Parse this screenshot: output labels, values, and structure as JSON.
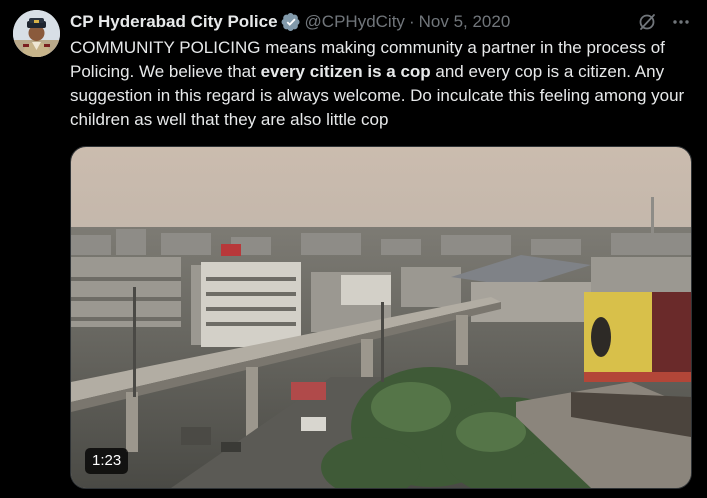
{
  "tweet": {
    "display_name": "CP Hyderabad City Police",
    "handle": "@CPHydCity",
    "separator": "·",
    "date": "Nov 5, 2020",
    "text_1": "COMMUNITY POLICING means making community a partner in the process of Policing. We believe that ",
    "text_bold": "every citizen is a cop",
    "text_2": " and every cop is a citizen. Any suggestion in this regard is always welcome. Do inculcate this feeling among your children as well that they are also  little cop"
  },
  "media": {
    "duration": "1:23"
  },
  "icons": {
    "verified": "verified-badge-icon",
    "grok": "grok-icon",
    "more": "more-icon"
  },
  "colors": {
    "background": "#000000",
    "text": "#e7e9ea",
    "secondary": "#71767b",
    "verified": "#829aab"
  }
}
